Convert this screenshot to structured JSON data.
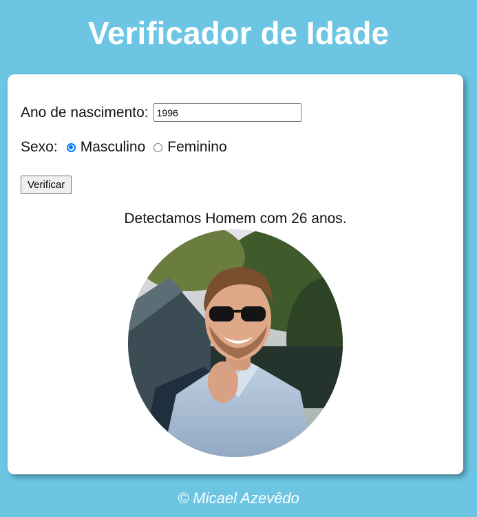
{
  "header": {
    "title": "Verificador de Idade"
  },
  "form": {
    "year_label": "Ano de nascimento:",
    "year_value": "1996",
    "sex_label": "Sexo:",
    "sex_options": [
      {
        "label": "Masculino",
        "checked": true
      },
      {
        "label": "Feminino",
        "checked": false
      }
    ],
    "submit_label": "Verificar"
  },
  "result": {
    "text": "Detectamos Homem com 26 anos.",
    "image": "smiling-man-with-sunglasses-photo"
  },
  "footer": {
    "text": "© Micael Azevêdo"
  },
  "colors": {
    "background": "#6cc5e3",
    "card": "#ffffff",
    "radio_accent": "#0075ff"
  }
}
